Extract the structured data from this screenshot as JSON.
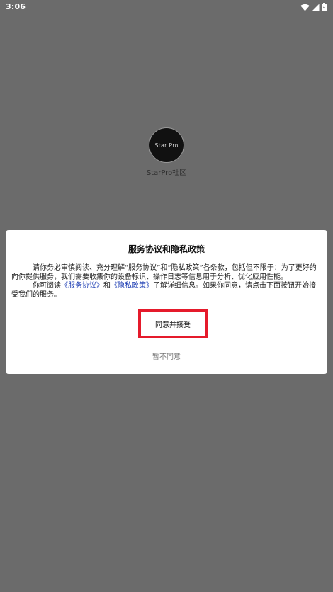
{
  "status_bar": {
    "time": "3:06",
    "icons": [
      "wifi-icon",
      "signal-icon",
      "battery-icon"
    ]
  },
  "app": {
    "logo_text": "Star Pro",
    "name": "StarPro社区"
  },
  "dialog": {
    "title": "服务协议和隐私政策",
    "paragraph1": "请你务必审慎阅读、充分理解“服务协议”和“隐私政策”各条款，包括但不限于：为了更好的向你提供服务，我们需要收集你的设备标识、操作日志等信息用于分析、优化应用性能。",
    "paragraph2_prefix": "你可阅读",
    "service_agreement_link": "《服务协议》",
    "paragraph2_and": "和",
    "privacy_policy_link": "《隐私政策》",
    "paragraph2_suffix": "了解详细信息。如果你同意，请点击下面按钮开始接受我们的服务。",
    "accept_label": "同意并接受",
    "decline_label": "暂不同意"
  },
  "colors": {
    "overlay": "#6b6b6b",
    "link": "#1f3fb4",
    "highlight_border": "#e51a2b"
  }
}
